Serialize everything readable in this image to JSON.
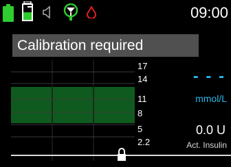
{
  "status_bar": {
    "battery_icon": "battery-full-icon",
    "reservoir_icon": "insulin-reservoir-icon",
    "sound_icon": "speaker-muted-icon",
    "sensor_icon": "sensor-signal-icon",
    "drop_icon": "blood-drop-icon",
    "time": "09:00",
    "colors": {
      "green": "#2ecc2e",
      "red": "#e02020"
    }
  },
  "banner": {
    "text": "Calibration required",
    "background": "#505050"
  },
  "graph": {
    "y_labels": [
      "17",
      "14",
      "11",
      "8",
      "5",
      "2.2"
    ],
    "target_range_color": "#0f5a1e",
    "lock_icon": "lock-icon"
  },
  "glucose": {
    "value": "- - -",
    "unit": "mmol/L",
    "color": "#29b6e8"
  },
  "insulin": {
    "value": "0.0 U",
    "label": "Act. Insulin"
  }
}
